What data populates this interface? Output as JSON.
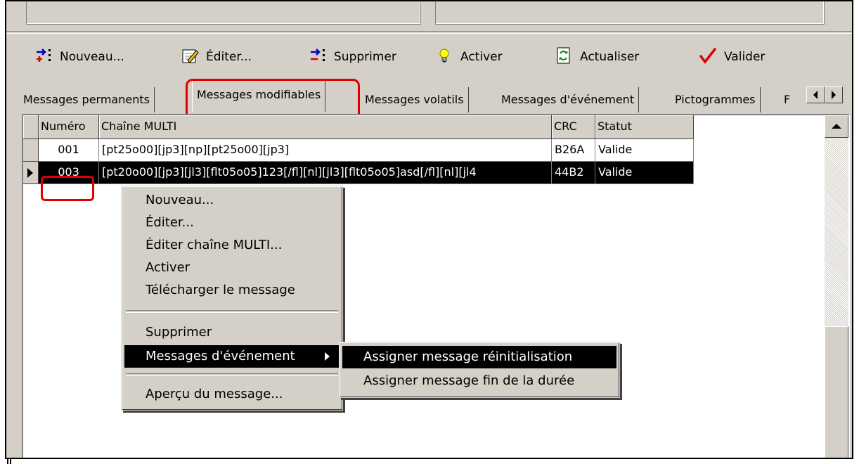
{
  "toolbar": {
    "new_label": "Nouveau...",
    "edit_label": "Éditer...",
    "delete_label": "Supprimer",
    "activate_label": "Activer",
    "refresh_label": "Actualiser",
    "validate_label": "Valider"
  },
  "tabs": [
    {
      "label": "Messages permanents"
    },
    {
      "label": "Messages modifiables"
    },
    {
      "label": "Messages volatils"
    },
    {
      "label": "Messages d'événement"
    },
    {
      "label": "Pictogrammes"
    },
    {
      "label": "F"
    }
  ],
  "grid": {
    "columns": [
      "Numéro",
      "Chaîne MULTI",
      "CRC",
      "Statut"
    ],
    "rows": [
      {
        "num": "001",
        "multi": "[pt25o00][jp3][np][pt25o00][jp3]",
        "crc": "B26A",
        "status": "Valide"
      },
      {
        "num": "003",
        "multi": "[pt20o00][jp3][jl3][flt05o05]123[/fl][nl][jl3][flt05o05]asd[/fl][nl][jl4",
        "crc": "44B2",
        "status": "Valide"
      }
    ]
  },
  "context_menu": {
    "items": [
      "Nouveau...",
      "Éditer...",
      "Éditer chaîne MULTI...",
      "Activer",
      "Télécharger le  message",
      "Supprimer",
      "Messages d'événement",
      "Aperçu du message..."
    ]
  },
  "submenu": {
    "items": [
      "Assigner message réinitialisation",
      "Assigner message fin de la durée"
    ]
  },
  "colors": {
    "highlight": "#e00000",
    "face": "#d4d0c8"
  }
}
